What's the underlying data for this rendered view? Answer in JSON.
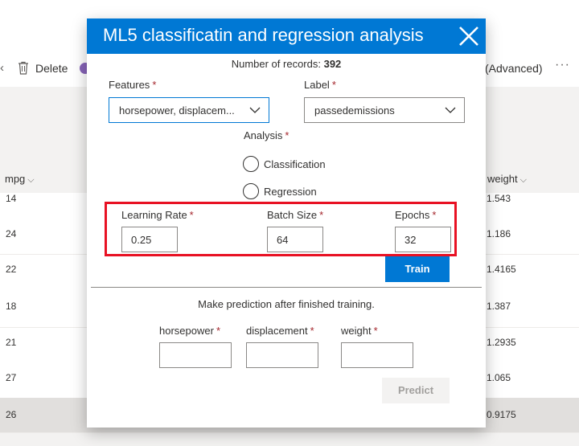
{
  "background": {
    "toolbar": {
      "back_glyph": "‹",
      "delete_label": "Delete",
      "advanced_label": "(Advanced)",
      "more_glyph": "···"
    },
    "columns": {
      "mpg": "mpg",
      "weight": "weight"
    },
    "rows": [
      {
        "mpg": "14",
        "weight": "1.543"
      },
      {
        "mpg": "24",
        "weight": "1.186"
      },
      {
        "mpg": "22",
        "weight": "1.4165"
      },
      {
        "mpg": "18",
        "weight": "1.387"
      },
      {
        "mpg": "21",
        "weight": "1.2935"
      },
      {
        "mpg": "27",
        "weight": "1.065"
      },
      {
        "mpg": "26",
        "weight": "0.9175"
      }
    ]
  },
  "dialog": {
    "title": "ML5 classificatin and regression analysis",
    "records_label": "Number of records:",
    "records_count": "392",
    "features": {
      "label": "Features",
      "value": "horsepower, displacem..."
    },
    "label_field": {
      "label": "Label",
      "value": "passedemissions"
    },
    "analysis": {
      "label": "Analysis",
      "options": [
        "Classification",
        "Regression"
      ]
    },
    "learning_rate": {
      "label": "Learning Rate",
      "value": "0.25"
    },
    "batch_size": {
      "label": "Batch Size",
      "value": "64"
    },
    "epochs": {
      "label": "Epochs",
      "value": "32"
    },
    "train_label": "Train",
    "prediction_note": "Make prediction after finished training.",
    "prediction_fields": [
      {
        "label": "horsepower",
        "value": ""
      },
      {
        "label": "displacement",
        "value": ""
      },
      {
        "label": "weight",
        "value": ""
      }
    ],
    "predict_label": "Predict",
    "required_mark": "*"
  },
  "colors": {
    "accent": "#0078d4",
    "highlight": "#e81123",
    "required": "#a4262c"
  }
}
